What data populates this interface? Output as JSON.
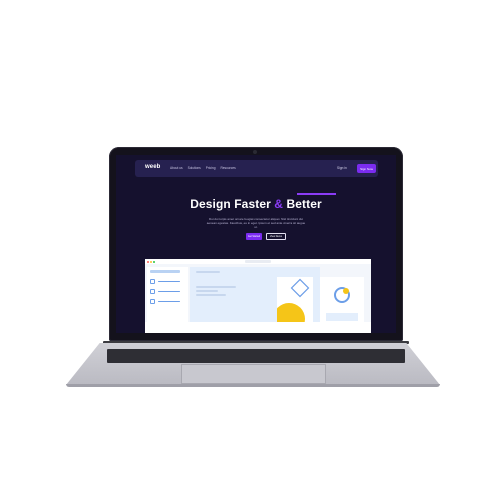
{
  "nav": {
    "logo": "weeb",
    "links": [
      "About us",
      "Solutions",
      "Pricing",
      "Resources"
    ],
    "signin": "Sign in",
    "cta": "Sign Now"
  },
  "hero": {
    "title_part1": "Design Faster ",
    "title_amp": "&",
    "title_part2": " Better",
    "subtitle": "Dui dui turpis amet ornare feugiat consectetur aliquet. Nisl tincidunt dui aenean egestas. Faucibus, eu in eget. Ipsum et sed ante viverra sit augue ut.",
    "primary_button": "Get Started",
    "secondary_button": "View Demo"
  },
  "colors": {
    "accent": "#7b2cf0",
    "background": "#15112e",
    "nav_bg": "#262150",
    "highlight": "#f5c518",
    "preview_blue": "#6c9ee8"
  },
  "icons": {
    "preview_card1": "shape-icon",
    "preview_card2": "avatar-ring-icon",
    "window_controls": "traffic-light-dots"
  }
}
